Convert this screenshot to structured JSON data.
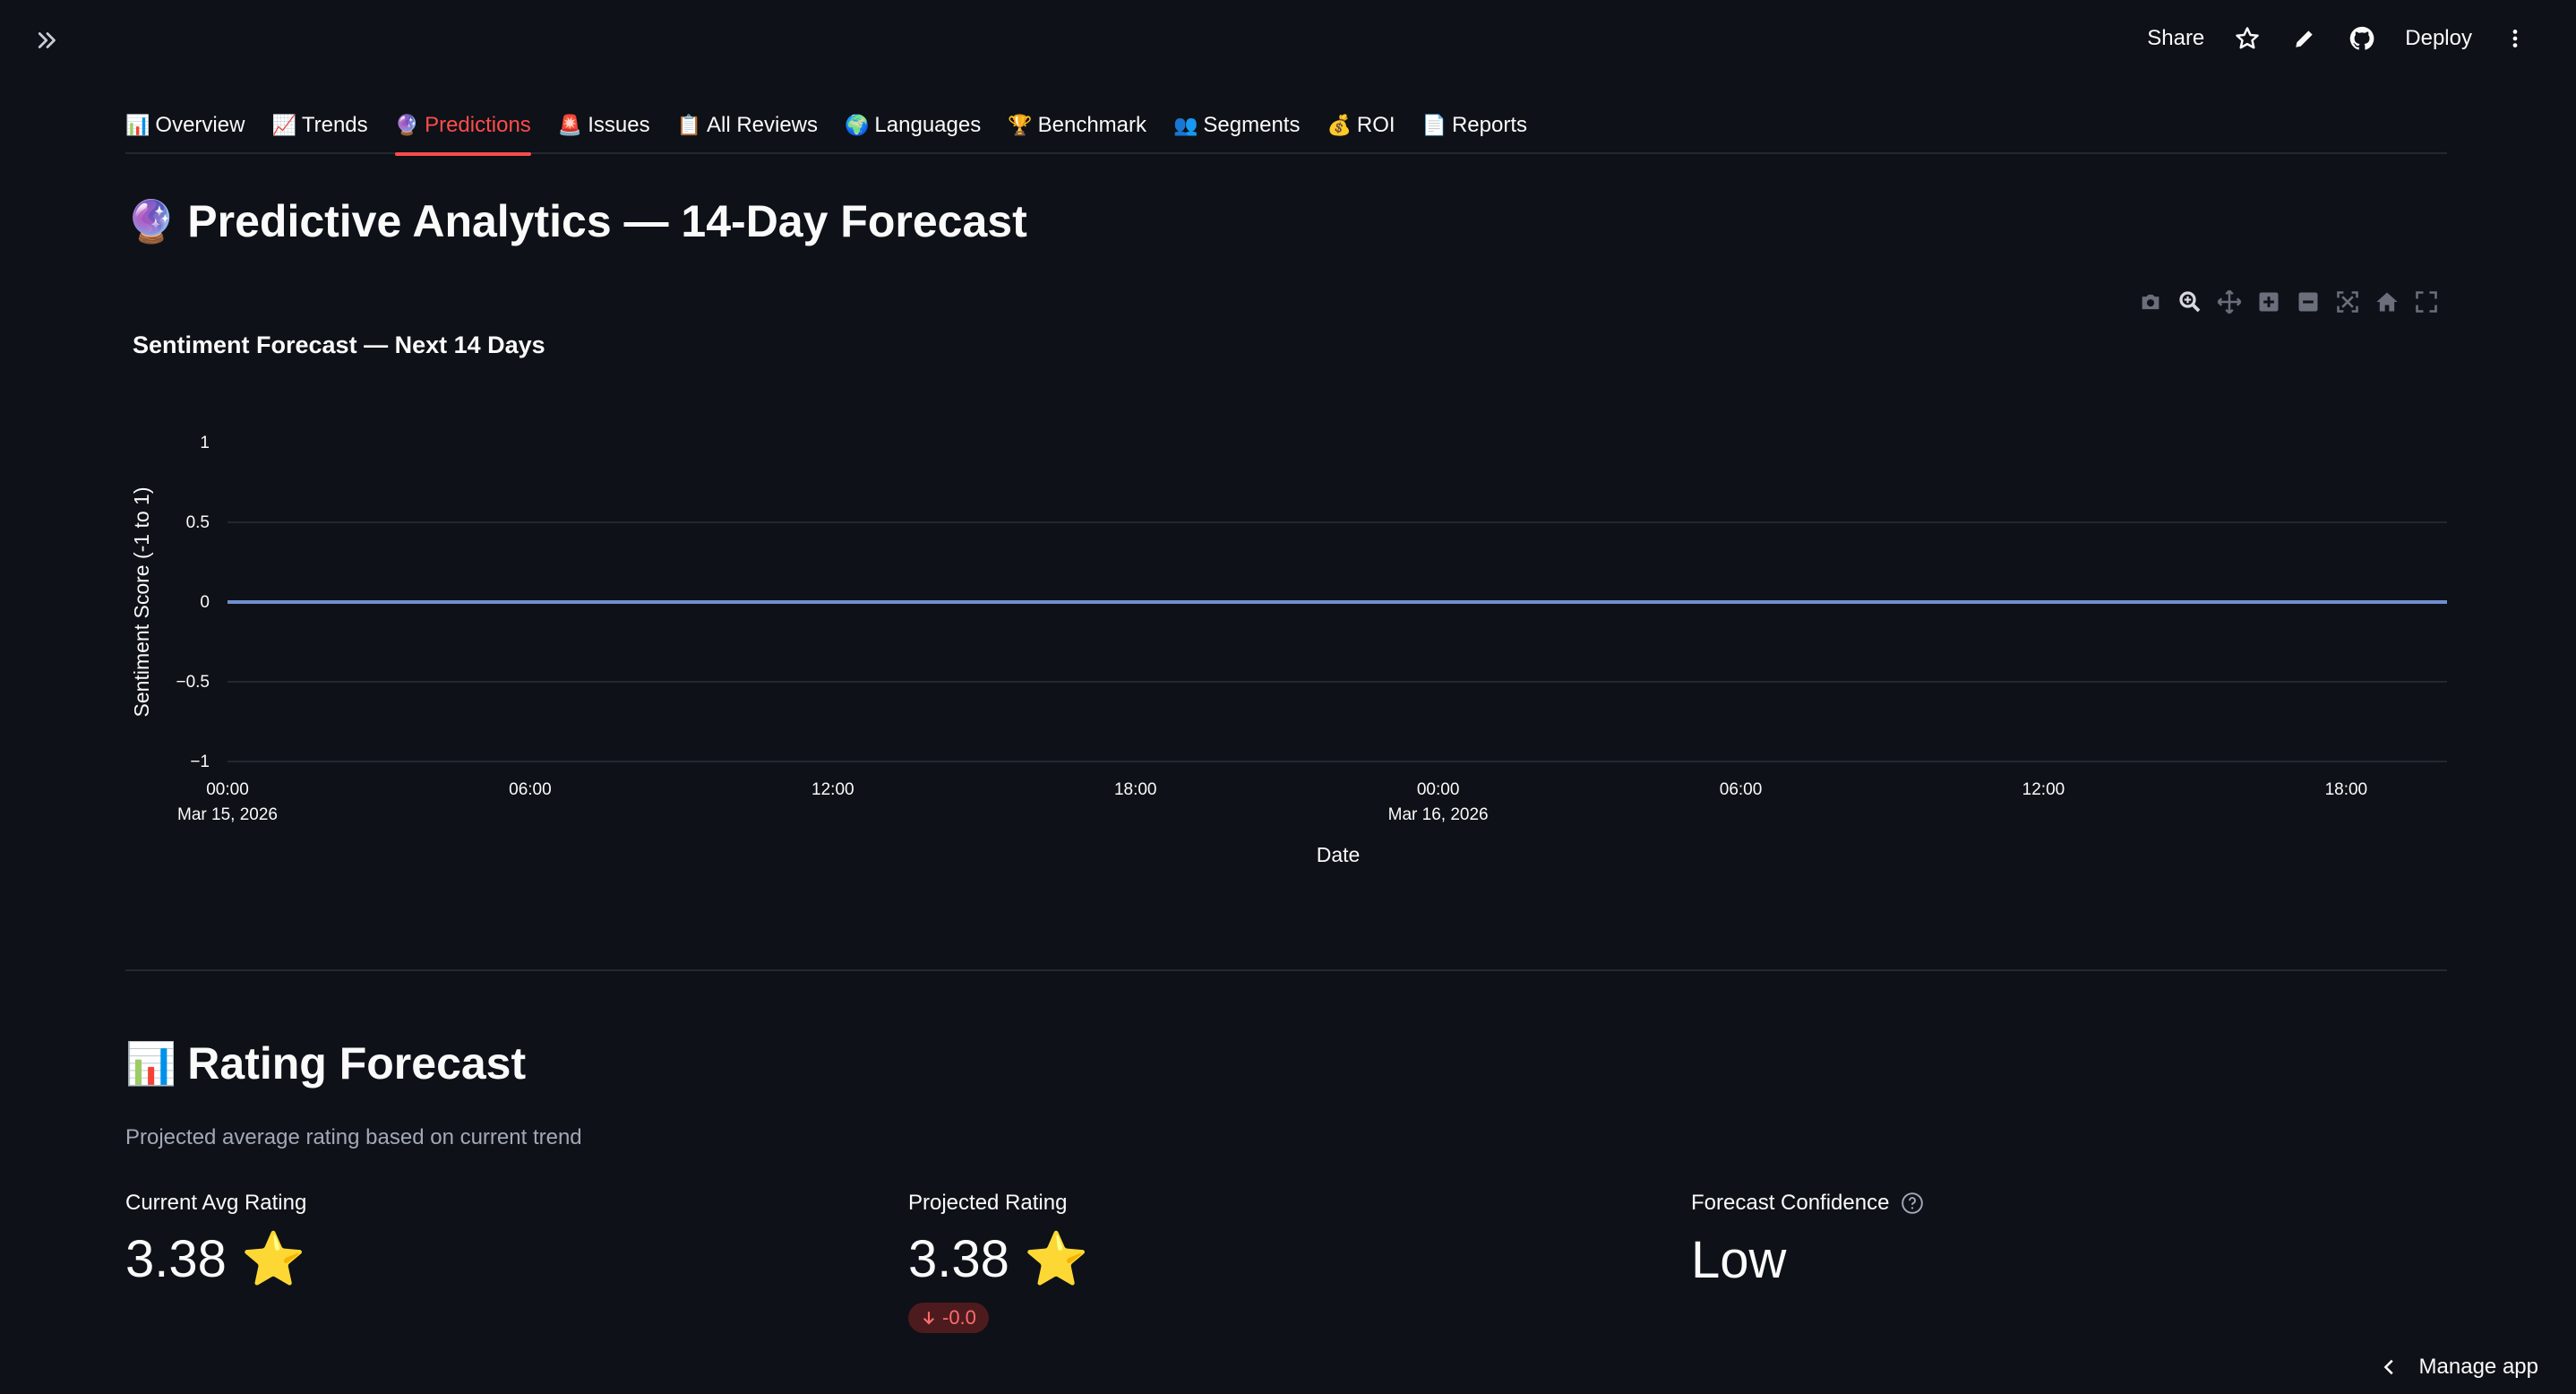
{
  "header": {
    "share_label": "Share",
    "deploy_label": "Deploy"
  },
  "tabs": [
    {
      "emoji": "📊",
      "label": "Overview"
    },
    {
      "emoji": "📈",
      "label": "Trends"
    },
    {
      "emoji": "🔮",
      "label": "Predictions"
    },
    {
      "emoji": "🚨",
      "label": "Issues"
    },
    {
      "emoji": "📋",
      "label": "All Reviews"
    },
    {
      "emoji": "🌍",
      "label": "Languages"
    },
    {
      "emoji": "🏆",
      "label": "Benchmark"
    },
    {
      "emoji": "👥",
      "label": "Segments"
    },
    {
      "emoji": "💰",
      "label": "ROI"
    },
    {
      "emoji": "📄",
      "label": "Reports"
    }
  ],
  "active_tab": "Predictions",
  "page": {
    "title_emoji": "🔮",
    "title": "Predictive Analytics — 14-Day Forecast"
  },
  "chart_data": {
    "type": "line",
    "title": "Sentiment Forecast — Next 14 Days",
    "xlabel": "Date",
    "ylabel": "Sentiment Score (-1 to 1)",
    "ylim": [
      -1,
      1
    ],
    "yticks": [
      "1",
      "0.5",
      "0",
      "−0.5",
      "−1"
    ],
    "xticks": [
      {
        "time": "00:00",
        "date": "Mar 15, 2026"
      },
      {
        "time": "06:00",
        "date": ""
      },
      {
        "time": "12:00",
        "date": ""
      },
      {
        "time": "18:00",
        "date": ""
      },
      {
        "time": "00:00",
        "date": "Mar 16, 2026"
      },
      {
        "time": "06:00",
        "date": ""
      },
      {
        "time": "12:00",
        "date": ""
      },
      {
        "time": "18:00",
        "date": ""
      }
    ],
    "x": [
      "2026-03-15 00:00",
      "2026-03-16 20:00"
    ],
    "series": [
      {
        "values": [
          0,
          0
        ],
        "color": "#636efa"
      }
    ],
    "grid": true,
    "line_color": "#6f8fd0"
  },
  "rating": {
    "title_emoji": "📊",
    "title": "Rating Forecast",
    "caption": "Projected average rating based on current trend",
    "metrics": [
      {
        "label": "Current Avg Rating",
        "value": "3.38 ⭐"
      },
      {
        "label": "Projected Rating",
        "value": "3.38 ⭐",
        "delta": "-0.0",
        "delta_icon": "arrow-down-icon"
      },
      {
        "label": "Forecast Confidence",
        "value": "Low",
        "help_icon": "question-circle-icon"
      }
    ]
  },
  "footer": {
    "manage_app_label": "Manage app"
  },
  "colors": {
    "background": "#0e1117",
    "accent": "#ff4b4b",
    "text": "#fafafa",
    "grid": "#2c2f38"
  }
}
